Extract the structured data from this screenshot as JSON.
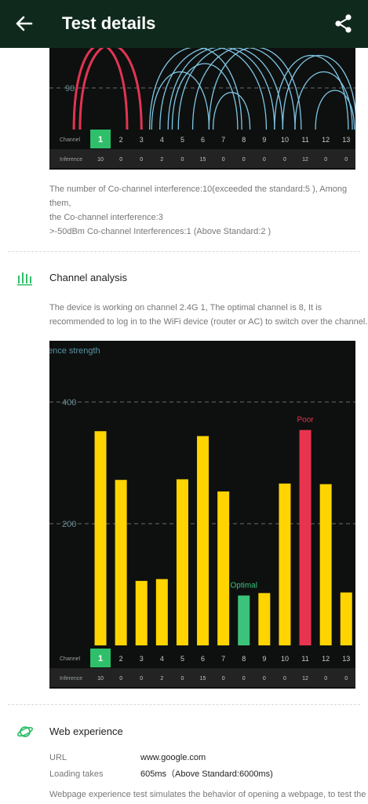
{
  "header": {
    "title": "Test details"
  },
  "interference_chart": {
    "y_tick": "90",
    "row_labels": {
      "channel": "Channel",
      "inference": "Inference"
    },
    "channels": [
      "1",
      "2",
      "3",
      "4",
      "5",
      "6",
      "7",
      "8",
      "9",
      "10",
      "11",
      "12",
      "13"
    ],
    "inference": [
      "10",
      "0",
      "0",
      "2",
      "0",
      "15",
      "0",
      "0",
      "0",
      "0",
      "12",
      "0",
      "0"
    ],
    "current_channel": "1",
    "colors": {
      "current": "#2fbf6a",
      "own_arcs": "#e23452",
      "other_arcs": "#7fc6e5"
    }
  },
  "interference_text": [
    "The number of Co-channel interference:10(exceeded the standard:5 ), Among them,",
    "the Co-channel interference:3",
    ">-50dBm Co-channel Interferences:1 (Above Standard:2 )"
  ],
  "channel_analysis": {
    "title": "Channel analysis",
    "icon": "bar-chart-icon",
    "description": [
      "The device is working on channel 2.4G 1, The optimal channel is 8, It is",
      "recommended to log in to the WiFi device (router or AC) to switch over the channel."
    ]
  },
  "chart_data": {
    "type": "bar",
    "ylabel": "ence strength",
    "y_ticks": [
      "400",
      "200"
    ],
    "ylim": [
      0,
      400
    ],
    "categories": [
      "1",
      "2",
      "3",
      "4",
      "5",
      "6",
      "7",
      "8",
      "9",
      "10",
      "11",
      "12",
      "13"
    ],
    "values": [
      352,
      272,
      106,
      109,
      273,
      344,
      253,
      82,
      86,
      266,
      354,
      265,
      87
    ],
    "inference": [
      "10",
      "0",
      "0",
      "2",
      "0",
      "15",
      "0",
      "0",
      "0",
      "0",
      "12",
      "0",
      "0"
    ],
    "current_channel": "1",
    "annotations": {
      "optimal": "Optimal",
      "poor": "Poor"
    },
    "optimal_index": 7,
    "poor_index": 10,
    "row_labels": {
      "channel": "Channel",
      "inference": "Inference"
    },
    "colors": {
      "normal": "#ffd400",
      "optimal": "#3cc27a",
      "poor": "#e8344e",
      "current": "#2fbf6a"
    },
    "grid": true
  },
  "web_experience": {
    "title": "Web experience",
    "icon": "planet-icon",
    "url_label": "URL",
    "url_value": "www.google.com",
    "loading_label": "Loading takes",
    "loading_value": "605ms（Above Standard:6000ms)",
    "description": "Webpage experience test simulates the behavior of opening a webpage, to test the"
  }
}
